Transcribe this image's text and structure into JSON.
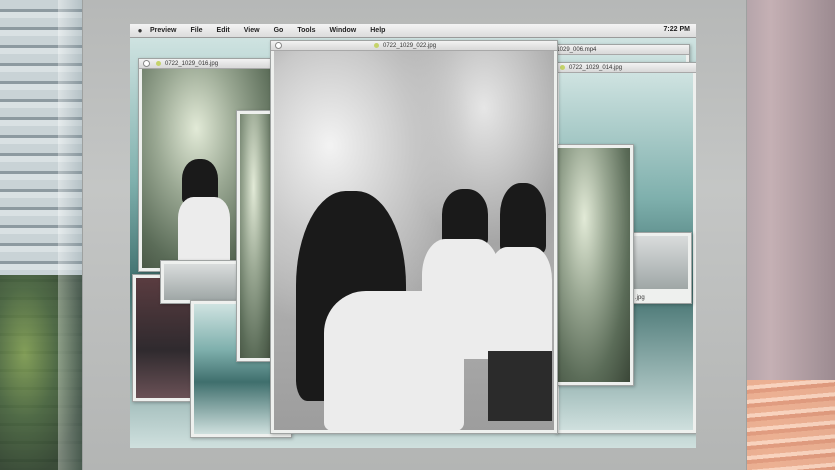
{
  "menubar": {
    "apple": "",
    "items": [
      "Preview",
      "File",
      "Edit",
      "View",
      "Go",
      "Tools",
      "Window",
      "Help"
    ],
    "clock": "7:22 PM"
  },
  "windows": {
    "w1": {
      "title": "0722_1029_016.jpg"
    },
    "w2": {
      "title": "0722_1029_022.jpg"
    },
    "w3": {
      "title": "_1029_006.mp4"
    },
    "w4": {
      "title": "0722_1029_014.jpg"
    },
    "w5": {
      "title": ".jpg"
    }
  },
  "icons": {
    "apple": "apple-logo-icon",
    "window_dot": "image-file-icon",
    "close": "close-icon"
  },
  "colors": {
    "menubar": "#e6e6e6",
    "window_chrome": "#eef0ee",
    "file_dot": "#c5d36a"
  }
}
